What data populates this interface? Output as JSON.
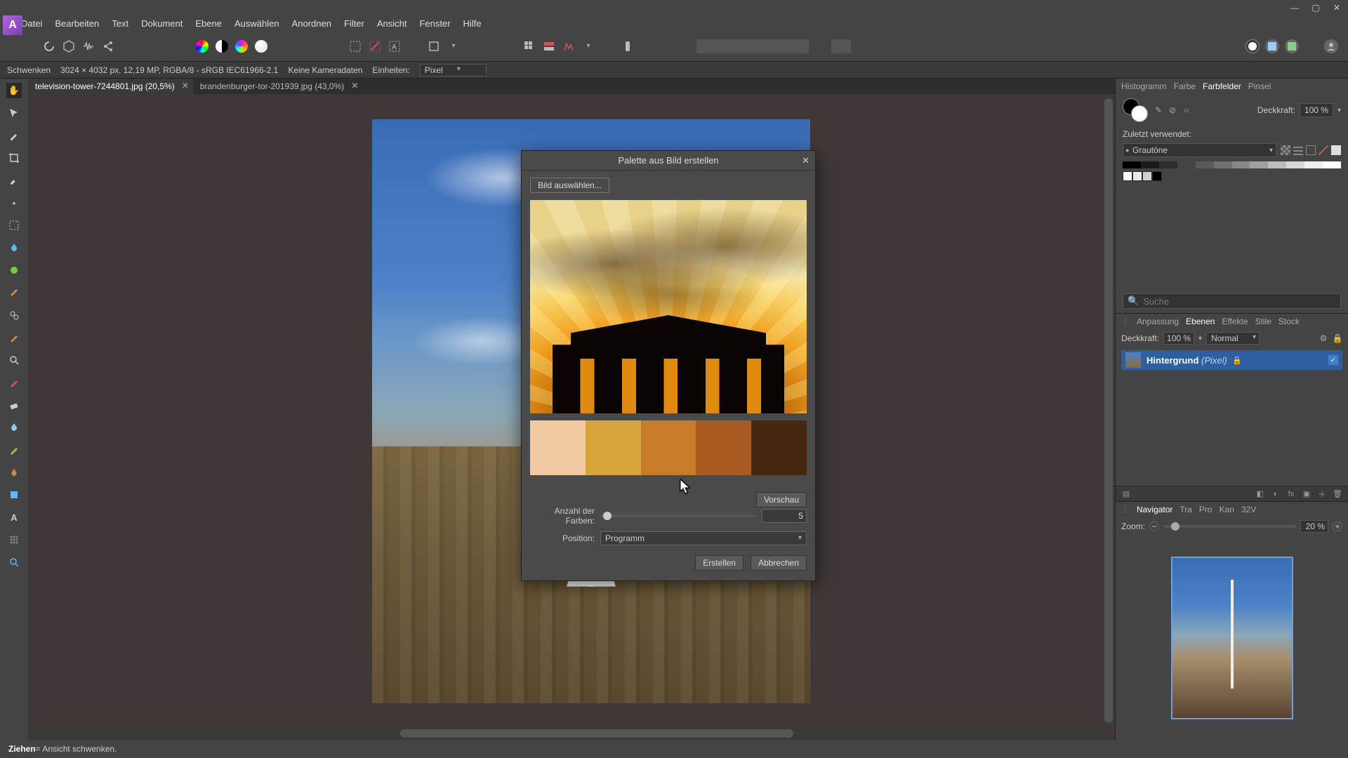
{
  "menu": {
    "items": [
      "Datei",
      "Bearbeiten",
      "Text",
      "Dokument",
      "Ebene",
      "Auswählen",
      "Anordnen",
      "Filter",
      "Ansicht",
      "Fenster",
      "Hilfe"
    ]
  },
  "context": {
    "tool": "Schwenken",
    "dims": "3024 × 4032 px, 12,19 MP, RGBA/8 - sRGB IEC61966-2.1",
    "camera": "Keine Kameradaten",
    "units_label": "Einheiten:",
    "units_value": "Pixel"
  },
  "tabs": [
    {
      "label": "television-tower-7244801.jpg (20,5%)",
      "active": true
    },
    {
      "label": "brandenburger-tor-201939.jpg (43,0%)",
      "active": false
    }
  ],
  "dialog": {
    "title": "Palette aus Bild erstellen",
    "choose_image": "Bild auswählen...",
    "count_label": "Anzahl der Farben:",
    "count_value": "5",
    "preview_btn": "Vorschau",
    "position_label": "Position:",
    "position_value": "Programm",
    "create": "Erstellen",
    "cancel": "Abbrechen",
    "swatches": [
      "#f2c9a0",
      "#d8a53c",
      "#c87c2a",
      "#a85a20",
      "#452810"
    ]
  },
  "swatches_panel": {
    "tabs": [
      "Histogramm",
      "Farbe",
      "Farbfelder",
      "Pinsel"
    ],
    "tab_selected": "Farbfelder",
    "opacity_label": "Deckkraft:",
    "opacity_value": "100 %",
    "recent_label": "Zuletzt verwendet:",
    "palette_name": "Grautöne",
    "search_placeholder": "Suche"
  },
  "layers_panel": {
    "tabs": [
      "Anpassung",
      "Ebenen",
      "Effekte",
      "Stile",
      "Stock"
    ],
    "tab_selected": "Ebenen",
    "opacity_label": "Deckkraft:",
    "opacity_value": "100 %",
    "blend_mode": "Normal",
    "layer_name": "Hintergrund",
    "layer_type": "(Pixel)"
  },
  "navigator_panel": {
    "tabs": [
      "Navigator",
      "Tra",
      "Pro",
      "Kan",
      "32V"
    ],
    "tab_selected": "Navigator",
    "zoom_label": "Zoom:",
    "zoom_value": "20 %"
  },
  "status": {
    "verb": "Ziehen",
    "desc": " = Ansicht schwenken."
  }
}
